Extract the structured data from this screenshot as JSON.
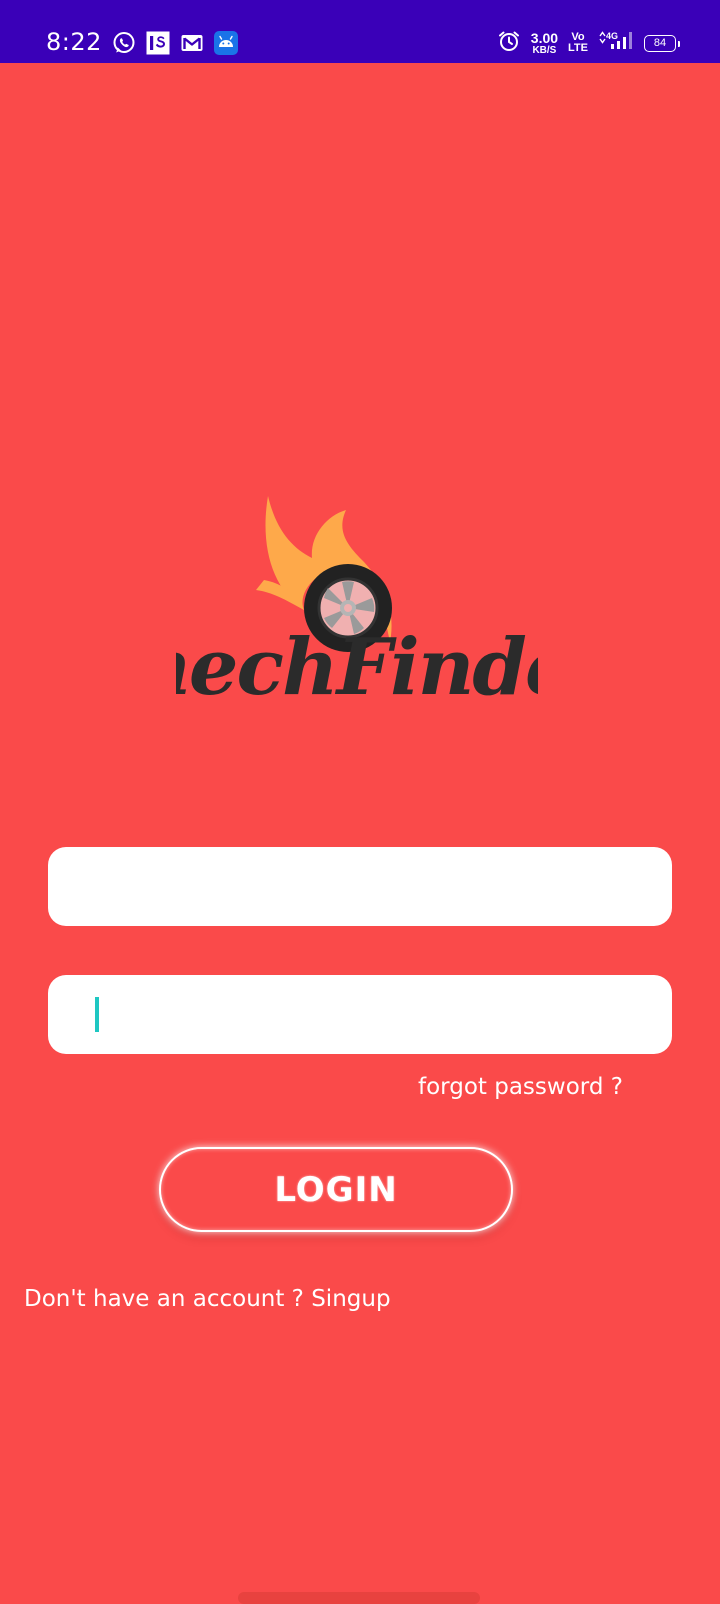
{
  "status_bar": {
    "time": "8:22",
    "notification_icons": [
      "whatsapp-icon",
      "is-app-icon",
      "gmail-icon",
      "android-icon"
    ],
    "net_speed_value": "3.00",
    "net_speed_unit": "KB/S",
    "volte_top": "Vo",
    "volte_bottom": "LTE",
    "network_type": "4G",
    "battery_level": "84",
    "colors": {
      "background": "#3A00B8",
      "foreground": "#FFFFFF"
    }
  },
  "logo": {
    "brand_name": "mechFinder",
    "icon": "tire-on-fire-logo"
  },
  "login_form": {
    "email_field": {
      "value": "",
      "placeholder": ""
    },
    "password_field": {
      "value": "",
      "placeholder": ""
    },
    "forgot_password_label": "forgot password ?",
    "login_button_label": "LOGIN"
  },
  "signup": {
    "prompt": "Don't have an account ?",
    "link_label": "Singup"
  },
  "colors": {
    "background": "#FA4A4A",
    "input_background": "#FFFFFF",
    "caret": "#1EC7C2",
    "text": "#FFFFFF"
  }
}
